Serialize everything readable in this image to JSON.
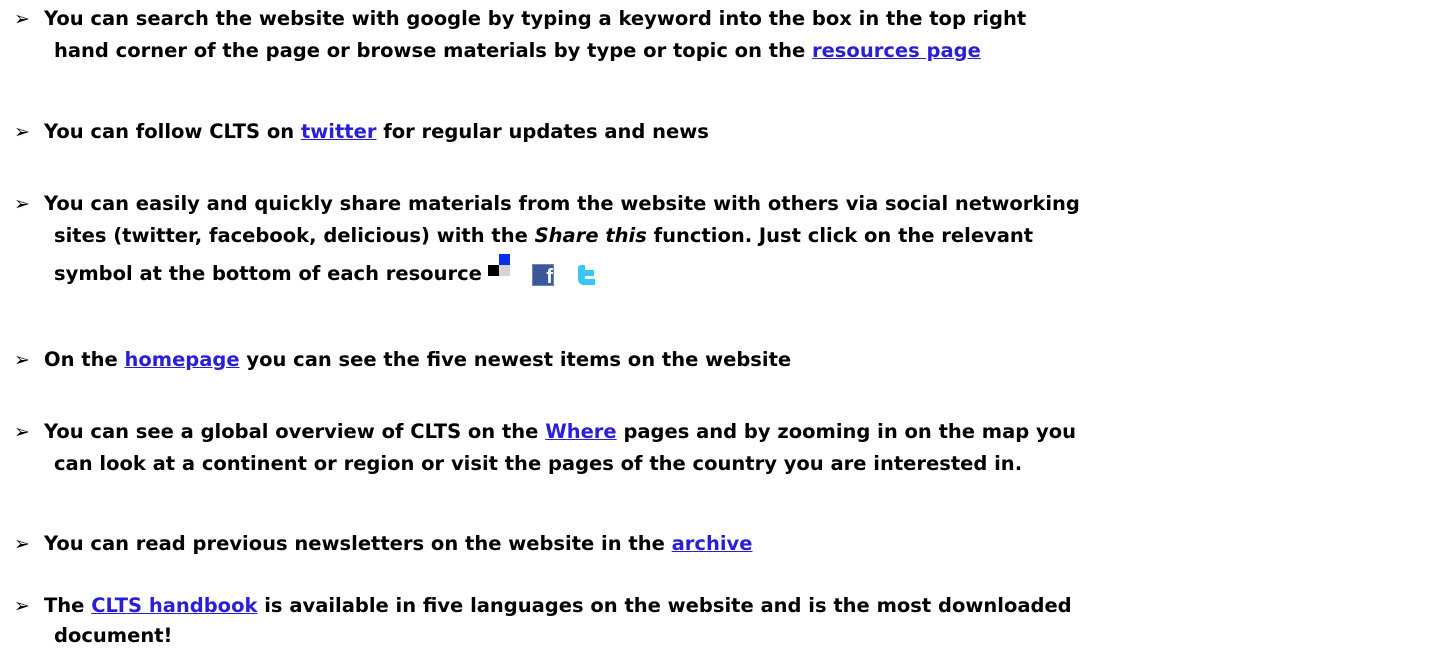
{
  "bullet_glyph": "➢",
  "colors": {
    "text": "#000000",
    "link": "#2a1fd9",
    "facebook": "#3b5998",
    "twitter": "#38c6f4",
    "delicious_blue": "#0b2df0"
  },
  "tips": [
    {
      "line1": "You can search the website with google by typing a keyword into the box in the top right",
      "line2_before": "hand corner of the page or browse materials by type or topic on the ",
      "link": "resources page"
    },
    {
      "before": "You can follow CLTS on ",
      "link": "twitter",
      "after": " for regular updates and news"
    },
    {
      "line1": "You can easily and quickly share materials from the website with others via social networking",
      "line2_before": "sites (twitter, facebook, delicious) with the ",
      "line2_italic": "Share this",
      "line2_after": " function. Just click on the relevant",
      "line3": "symbol at the bottom of each resource",
      "icons": [
        "delicious-icon",
        "facebook-icon",
        "twitter-icon"
      ],
      "facebook_glyph": "f"
    },
    {
      "before": "On the ",
      "link": "homepage",
      "after": " you can see the five newest items on the website"
    },
    {
      "line1_before": "You can see a global overview of CLTS on the ",
      "link": "Where",
      "line1_after": " pages and by zooming in on the map you",
      "line2": "can look at a continent or region or visit the pages of the country you are interested in."
    },
    {
      "before": "You can read previous newsletters on the website in the ",
      "link": "archive"
    },
    {
      "line1_before": "The ",
      "link": "CLTS handbook",
      "line1_after": " is available in five languages on the website and is the most downloaded",
      "line2": "document!"
    }
  ]
}
